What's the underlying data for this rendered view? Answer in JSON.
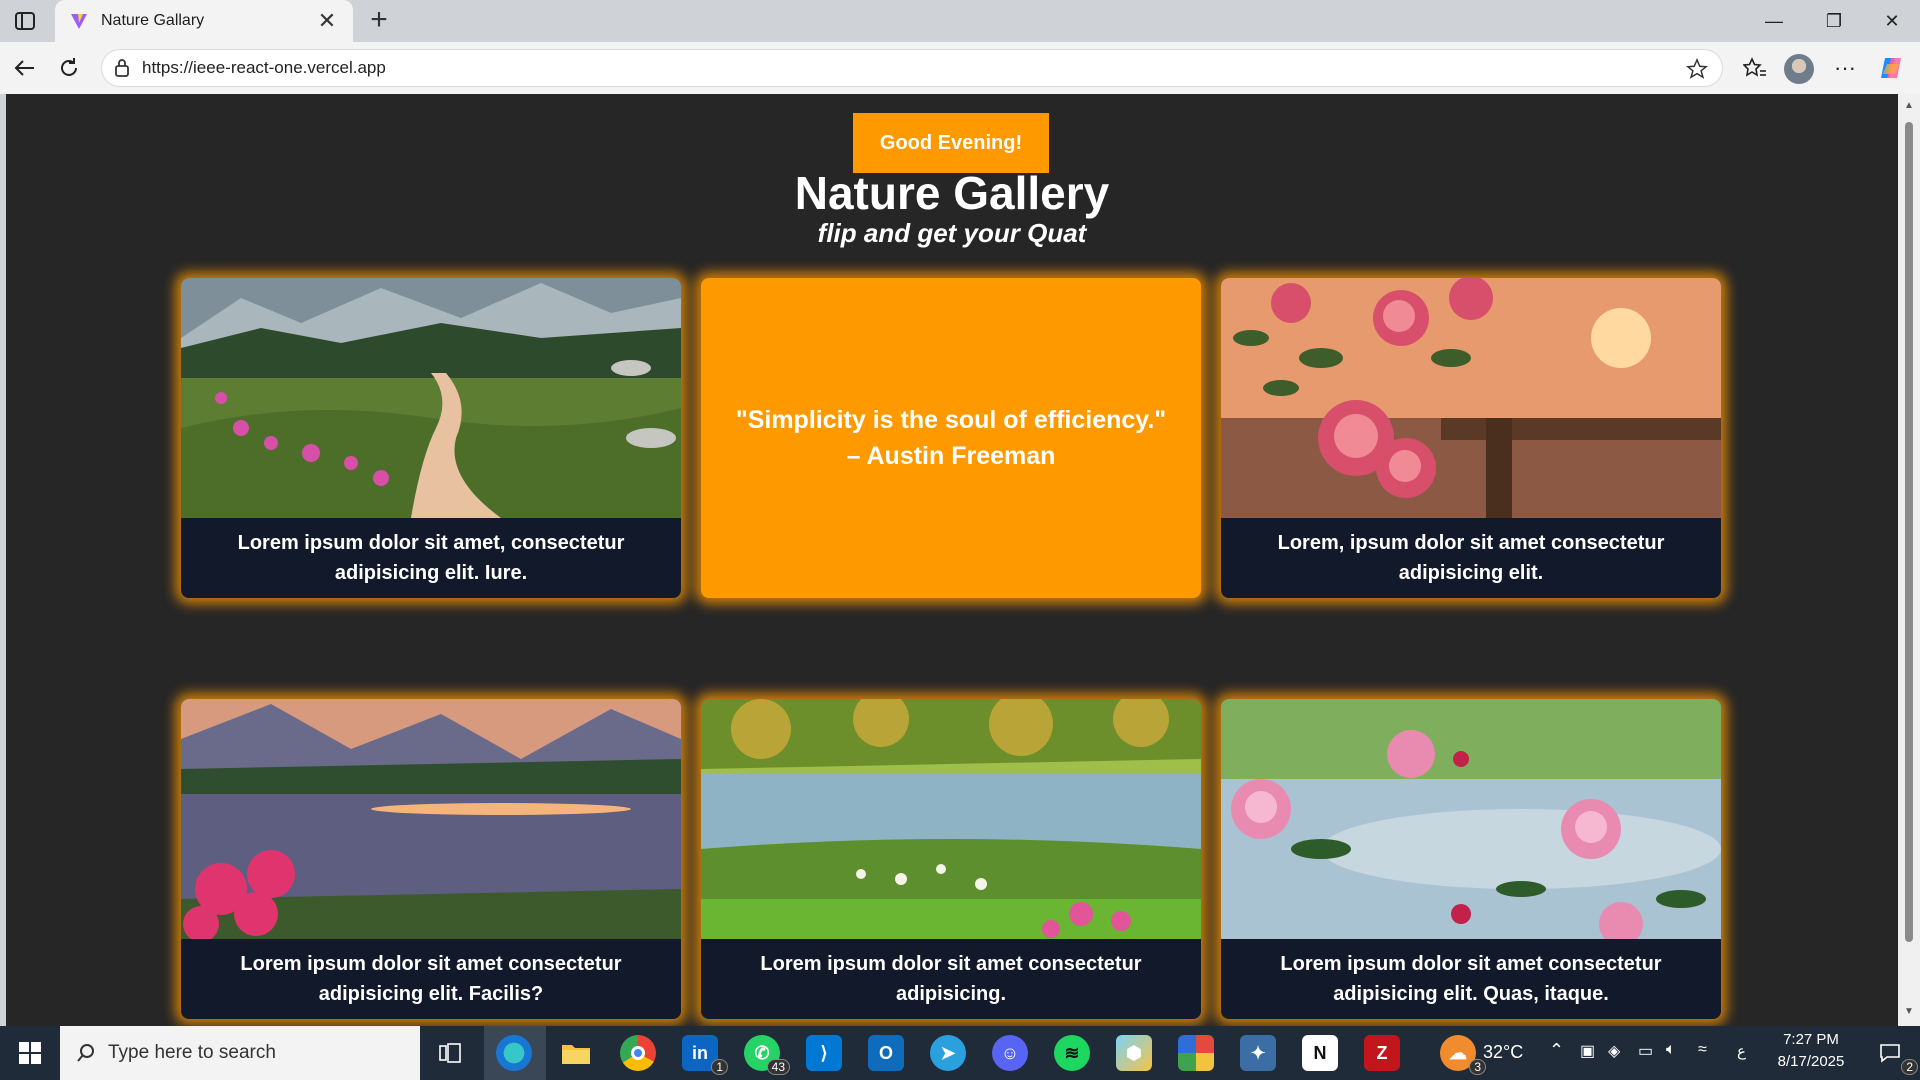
{
  "browser": {
    "tab_title": "Nature Gallary",
    "url": "https://ieee-react-one.vercel.app"
  },
  "page": {
    "greeting_button": "Good Evening!",
    "title": "Nature Gallery",
    "subtitle": "flip and get your Quat",
    "cards": [
      {
        "caption": "Lorem ipsum dolor sit amet, consectetur adipisicing elit. Iure."
      },
      {
        "quote": "\"Simplicity is the soul of efficiency.\" – Austin Freeman"
      },
      {
        "caption": "Lorem, ipsum dolor sit amet consectetur adipisicing elit."
      },
      {
        "caption": "Lorem ipsum dolor sit amet consectetur adipisicing elit. Facilis?"
      },
      {
        "caption": "Lorem ipsum dolor sit amet consectetur adipisicing."
      },
      {
        "caption": "Lorem ipsum dolor sit amet consectetur adipisicing elit. Quas, itaque."
      }
    ],
    "accent_color": "#ff9900",
    "background_color": "#262626"
  },
  "taskbar": {
    "search_placeholder": "Type here to search",
    "linkedin_badge": "1",
    "whatsapp_badge": "43",
    "weather_badge": "3",
    "temperature": "32°C",
    "ime": "ع",
    "time": "7:27 PM",
    "date": "8/17/2025",
    "notification_count": "2"
  }
}
